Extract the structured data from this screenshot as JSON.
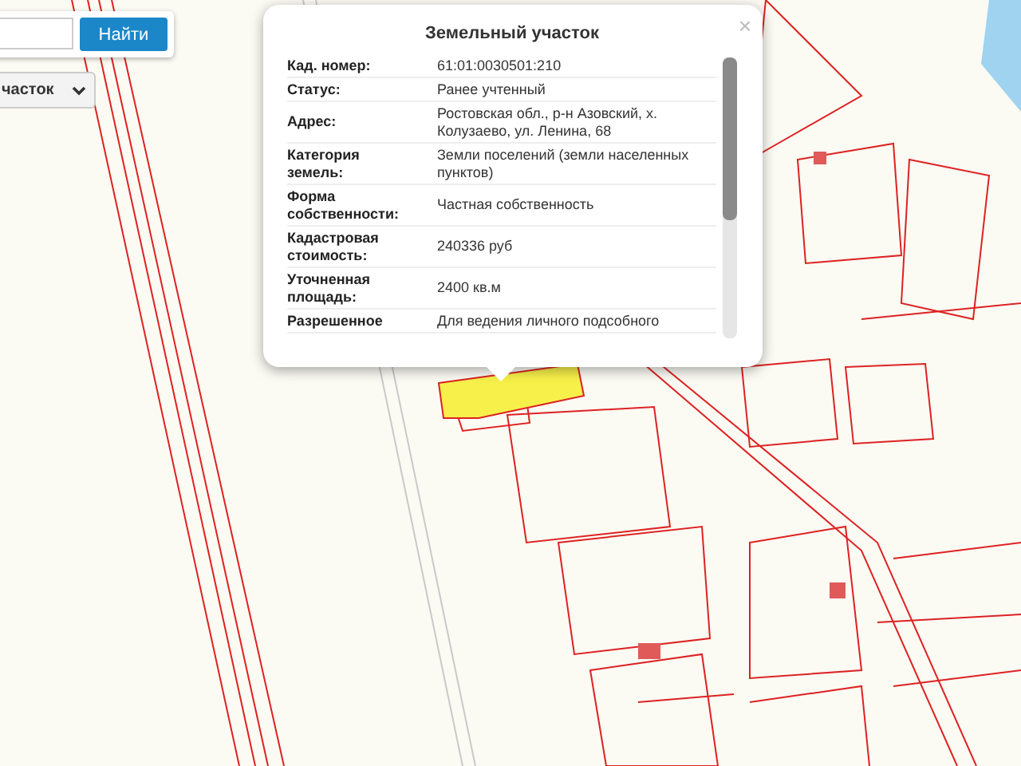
{
  "search": {
    "button": "Найти"
  },
  "layer_select": {
    "value": "часток"
  },
  "popup": {
    "title": "Земельный участок",
    "close": "×",
    "rows": [
      {
        "label": "Кад. номер:",
        "value": "61:01:0030501:210"
      },
      {
        "label": "Статус:",
        "value": "Ранее учтенный"
      },
      {
        "label": "Адрес:",
        "value": "Ростовская обл., р-н Азовский, х. Колузаево, ул. Ленина, 68"
      },
      {
        "label": "Категория земель:",
        "value": "Земли поселений (земли населенных пунктов)"
      },
      {
        "label": "Форма собственности:",
        "value": "Частная собственность"
      },
      {
        "label": "Кадастровая стоимость:",
        "value": "240336 руб"
      },
      {
        "label": "Уточненная площадь:",
        "value": "2400 кв.м"
      },
      {
        "label": "Разрешенное",
        "value": "Для ведения личного подсобного"
      }
    ]
  }
}
